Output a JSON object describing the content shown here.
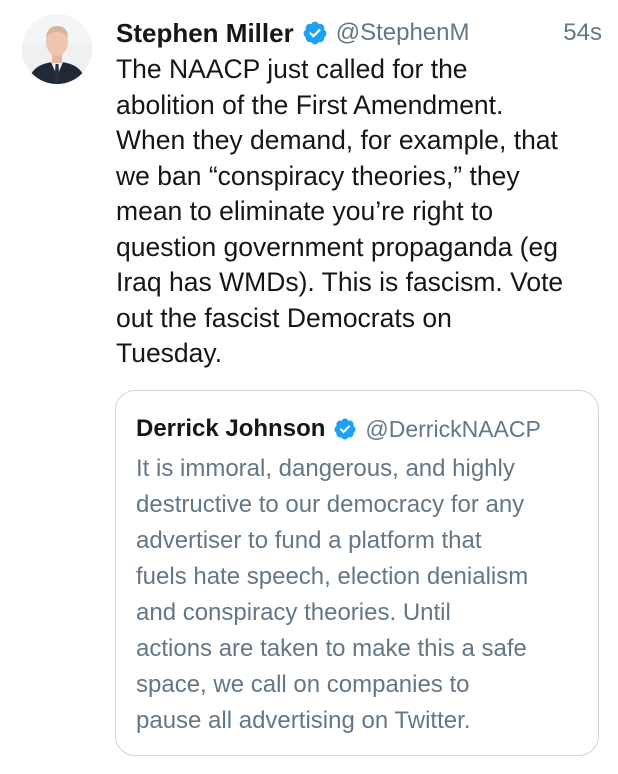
{
  "tweet": {
    "author": {
      "name": "Stephen Miller",
      "handle": "@StephenM",
      "avatar_icon": "profile-photo"
    },
    "timestamp": "54s",
    "text": "The NAACP just called for the\nabolition of the First Amendment.\nWhen they demand, for example, that\nwe ban “conspiracy theories,” they\nmean to eliminate you’re right to\nquestion government propaganda (eg\nIraq has WMDs). This is fascism. Vote\nout the fascist Democrats on\nTuesday."
  },
  "quote": {
    "author": {
      "name": "Derrick Johnson",
      "handle": "@DerrickNAACP"
    },
    "text": "It is immoral, dangerous, and highly\ndestructive to our democracy for any\nadvertiser to fund a platform that\nfuels hate speech, election denialism\nand conspiracy theories. Until\nactions are taken to make this a safe\nspace, we call on companies to\npause all advertising on Twitter."
  },
  "colors": {
    "verified_badge": "#1da1f2",
    "secondary_text": "#657786",
    "primary_text": "#14171a",
    "card_border": "#ccd6dd"
  }
}
